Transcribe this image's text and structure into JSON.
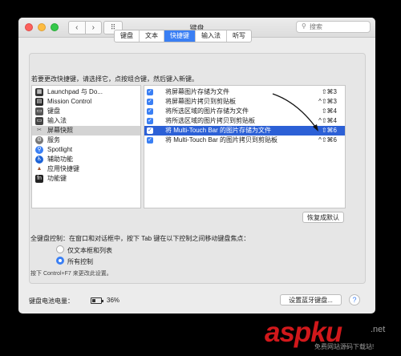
{
  "window": {
    "title": "键盘"
  },
  "search": {
    "placeholder": "搜索"
  },
  "tabs": [
    {
      "label": "键盘",
      "active": false
    },
    {
      "label": "文本",
      "active": false
    },
    {
      "label": "快捷键",
      "active": true
    },
    {
      "label": "输入法",
      "active": false
    },
    {
      "label": "听写",
      "active": false
    }
  ],
  "instruction": "若要更改快捷键，请选择它，点按组合键，然后键入新键。",
  "categories": [
    {
      "label": "Launchpad 与 Do...",
      "icon": "launchpad-icon"
    },
    {
      "label": "Mission Control",
      "icon": "mission-control-icon"
    },
    {
      "label": "键盘",
      "icon": "keyboard-icon"
    },
    {
      "label": "输入法",
      "icon": "input-source-icon"
    },
    {
      "label": "屏幕快照",
      "icon": "screenshot-icon",
      "selected": true
    },
    {
      "label": "服务",
      "icon": "services-icon"
    },
    {
      "label": "Spotlight",
      "icon": "spotlight-icon"
    },
    {
      "label": "辅助功能",
      "icon": "accessibility-icon"
    },
    {
      "label": "应用快捷键",
      "icon": "app-shortcuts-icon"
    },
    {
      "label": "功能键",
      "icon": "function-keys-icon"
    }
  ],
  "shortcuts": [
    {
      "label": "将屏幕图片存储为文件",
      "key": "⇧⌘3",
      "checked": true
    },
    {
      "label": "将屏幕图片拷贝到剪贴板",
      "key": "^⇧⌘3",
      "checked": true
    },
    {
      "label": "将所选区域的图片存储为文件",
      "key": "⇧⌘4",
      "checked": true
    },
    {
      "label": "将所选区域的图片拷贝到剪贴板",
      "key": "^⇧⌘4",
      "checked": true
    },
    {
      "label": "将 Multi-Touch Bar 的图片存储为文件",
      "key": "⇧⌘6",
      "checked": true,
      "selected": true
    },
    {
      "label": "将 Multi-Touch Bar 的图片拷贝到剪贴板",
      "key": "^⇧⌘6",
      "checked": true
    }
  ],
  "restore_defaults": "恢复成默认",
  "full_keyboard_access": {
    "label": "全键盘控制：在窗口和对话框中，按下 Tab 键在以下控制之间移动键盘焦点：",
    "options": [
      {
        "label": "仅文本框和列表",
        "selected": false
      },
      {
        "label": "所有控制",
        "selected": true
      }
    ],
    "hint": "按下 Control+F7 来更改此设置。"
  },
  "battery": {
    "label": "键盘电池电量：",
    "percent_text": "36%",
    "level": 0.36
  },
  "bluetooth_button": "设置蓝牙键盘...",
  "help_label": "?",
  "watermark": {
    "main": "aspku",
    "net": ".net",
    "sub": "免费网站源码下载站!"
  },
  "colors": {
    "accent": "#3a7ff4",
    "selection": "#2c60d6",
    "watermark": "#d1181b"
  }
}
